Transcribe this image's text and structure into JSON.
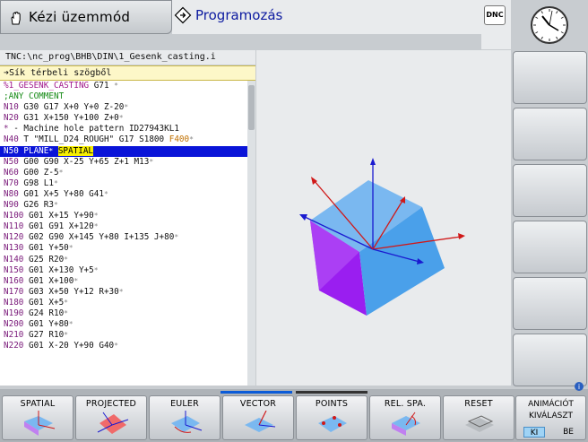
{
  "header": {
    "mode_manual": "Kézi üzemmód",
    "mode_programming": "Programozás",
    "dnc_label": "DNC"
  },
  "program": {
    "path": "TNC:\\nc_prog\\BHB\\DIN\\1_Gesenk_casting.i",
    "cycle_title": "➔Sík térbeli szögből",
    "lines": [
      {
        "blk": "%1_GESENK_CASTING",
        "rest": " G71 ",
        "mk": "*",
        "cls": "hdr"
      },
      {
        "blk": ";ANY COMMENT",
        "rest": "",
        "mk": "",
        "cls": "cmt"
      },
      {
        "blk": "N10",
        "rest": " G30 G17 X+0 Y+0 Z-20",
        "mk": "*"
      },
      {
        "blk": "N20",
        "rest": " G31 X+150 Y+100 Z+0",
        "mk": "*"
      },
      {
        "blk": "*",
        "rest": " - Machine hole pattern ID27943KL1",
        "mk": ""
      },
      {
        "blk": "N40",
        "rest": " T \"MILL_D24_ROUGH\" G17 S1800 ",
        "feed": "F400",
        "mk": "*"
      },
      {
        "blk": "N50",
        "rest": " PLANE",
        "mk": "*",
        "hl": "SPATIAL",
        "sel": true
      },
      {
        "blk": "N50",
        "rest": " G00 G90 X-25 Y+65 Z+1 M13",
        "mk": "*"
      },
      {
        "blk": "N60",
        "rest": " G00 Z-5",
        "mk": "*"
      },
      {
        "blk": "N70",
        "rest": " G98 L1",
        "mk": "*"
      },
      {
        "blk": "N80",
        "rest": " G01 X+5 Y+80 G41",
        "mk": "*"
      },
      {
        "blk": "N90",
        "rest": " G26 R3",
        "mk": "*"
      },
      {
        "blk": "N100",
        "rest": " G01 X+15 Y+90",
        "mk": "*"
      },
      {
        "blk": "N110",
        "rest": " G01 G91 X+120",
        "mk": "*"
      },
      {
        "blk": "N120",
        "rest": " G02 G90 X+145 Y+80 I+135 J+80",
        "mk": "*"
      },
      {
        "blk": "N130",
        "rest": " G01 Y+50",
        "mk": "*"
      },
      {
        "blk": "N140",
        "rest": " G25 R20",
        "mk": "*"
      },
      {
        "blk": "N150",
        "rest": " G01 X+130 Y+5",
        "mk": "*"
      },
      {
        "blk": "N160",
        "rest": " G01 X+100",
        "mk": "*"
      },
      {
        "blk": "N170",
        "rest": " G03 X+50 Y+12 R+30",
        "mk": "*"
      },
      {
        "blk": "N180",
        "rest": " G01 X+5",
        "mk": "*"
      },
      {
        "blk": "N190",
        "rest": " G24 R10",
        "mk": "*"
      },
      {
        "blk": "N200",
        "rest": " G01 Y+80",
        "mk": "*"
      },
      {
        "blk": "N210",
        "rest": " G27 R10",
        "mk": "*"
      },
      {
        "blk": "N220",
        "rest": " G01 X-20 Y+90 G40",
        "mk": "*"
      }
    ]
  },
  "softkeys": {
    "bottom": [
      "SPATIAL",
      "PROJECTED",
      "EULER",
      "VECTOR",
      "POINTS",
      "REL. SPA.",
      "RESET"
    ],
    "animation_line1": "ANIMÁCIÓT",
    "animation_line2": "KIVÁLASZT",
    "toggle_off": "KI",
    "toggle_on": "BE"
  },
  "colors": {
    "selection": "#0a14d8",
    "highlight": "#f7ef00",
    "plane_light": "#7ab8f0",
    "plane_purple": "#9a1ef0",
    "program_header": "#0c1aa0"
  }
}
